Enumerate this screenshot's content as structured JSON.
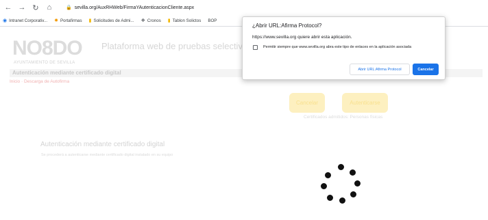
{
  "browser": {
    "url": "sevilla.org/AuxRHWeb/FirmaYAutenticacionCliente.aspx",
    "bookmarks": [
      {
        "label": "Intranet Corporativ...",
        "icon": "chrome-icon"
      },
      {
        "label": "Portafirmas",
        "icon": "portafirmas-icon"
      },
      {
        "label": "Solicitudes de Admi...",
        "icon": "folder-icon"
      },
      {
        "label": "Cronos",
        "icon": "cronos-icon"
      },
      {
        "label": "Tablon Solictos",
        "icon": "folder-icon"
      },
      {
        "label": "BOP",
        "icon": "globe-icon"
      }
    ]
  },
  "header": {
    "logo": "NO8DO",
    "logo_subtitle": "AYUNTAMIENTO DE SEVILLA",
    "platform_title": "Plataforma web de pruebas selectivas y pro"
  },
  "section": {
    "title": "Autenticación mediante certificado digital",
    "breadcrumb": "Inicio · Descarga de Autofirma"
  },
  "actions": {
    "cancel_label": "Cancelar",
    "authenticate_label": "Autenticarse",
    "subtitle": "Certificados admitidos: Personas físicas"
  },
  "auth": {
    "heading": "Autenticación mediante certificado digital",
    "description": "Se procederá a autenticarse mediante certificado digital instalado en su equipo"
  },
  "dialog": {
    "title": "¿Abrir URL:Afirma Protocol?",
    "message": "https://www.sevilla.org quiere abrir esta aplicación.",
    "checkbox_label": "Permitir siempre que www.sevilla.org abra este tipo de enlaces en la aplicación asociada",
    "checkbox_checked": false,
    "open_button": "Abrir URL:Afirma Protocol",
    "cancel_button": "Cancelar"
  },
  "colors": {
    "accent": "#1a73e8",
    "button_soft": "#fdf0c0",
    "spinner": "#111111"
  }
}
